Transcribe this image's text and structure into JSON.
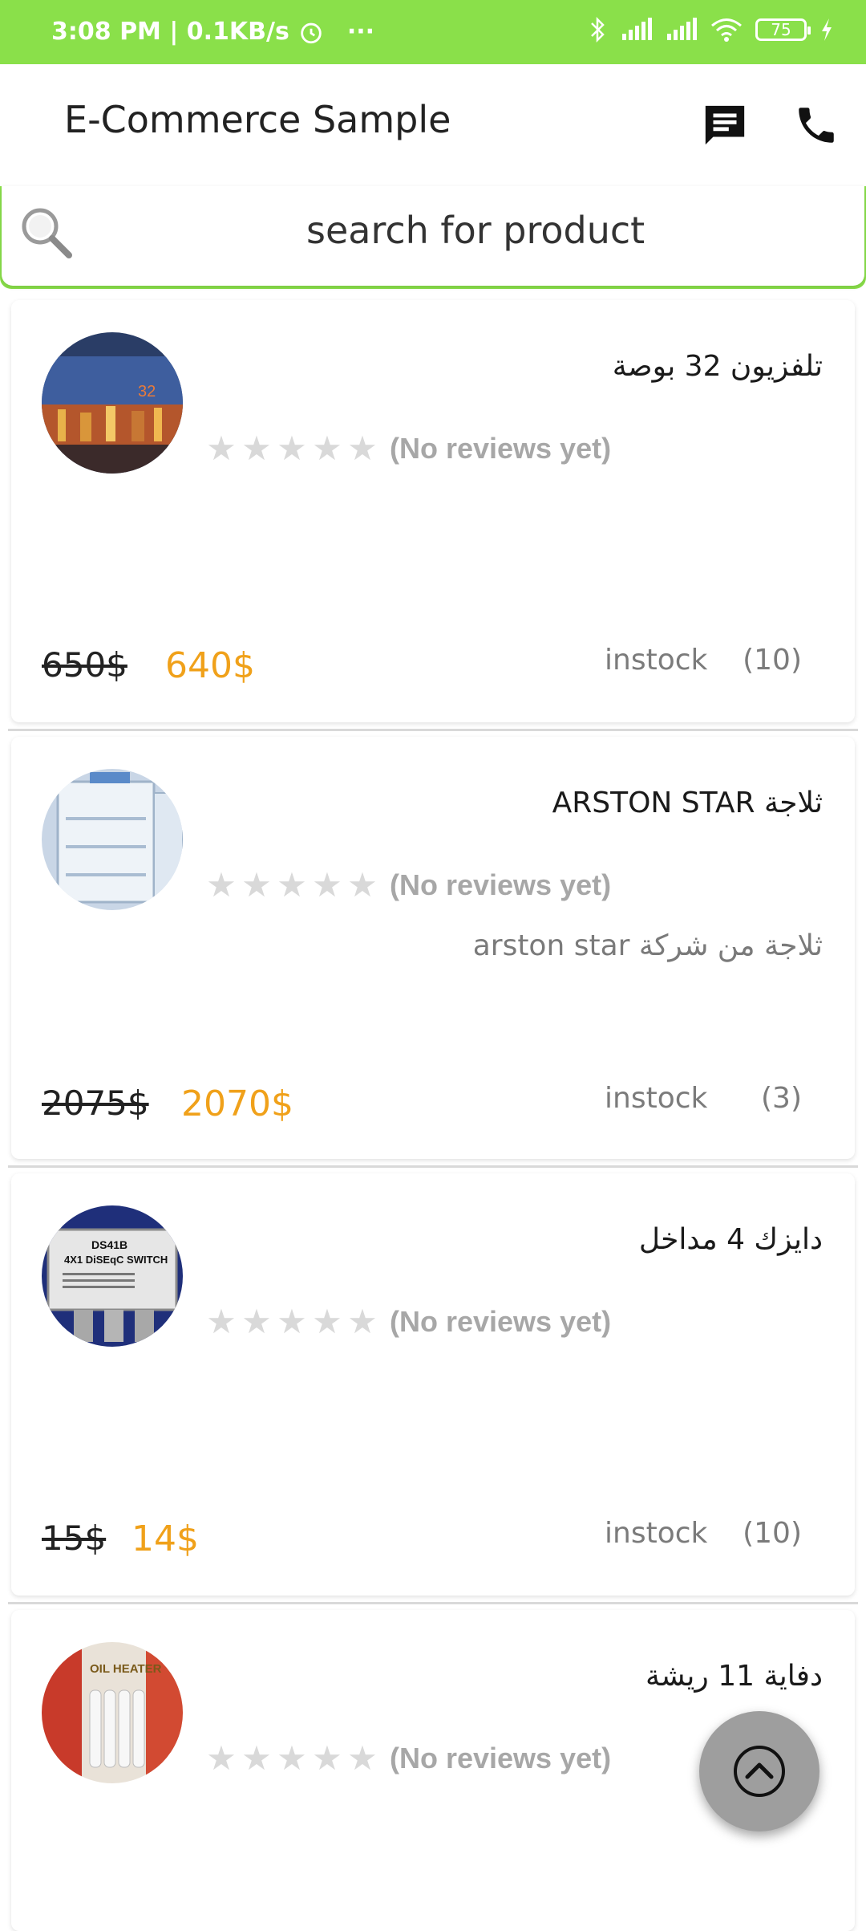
{
  "status_bar": {
    "time": "3:08 PM | 0.1KB/s",
    "more": "···",
    "battery": "75"
  },
  "app_bar": {
    "title": "E-Commerce Sample",
    "icons": [
      "chat-icon",
      "phone-icon"
    ]
  },
  "search": {
    "placeholder": "search for product"
  },
  "rating": {
    "no_reviews_label": "(No reviews yet)"
  },
  "products": [
    {
      "title": "تلفزيون 32 بوصة",
      "description": "",
      "old_price": "650$",
      "new_price": "640$",
      "stock_label": "instock",
      "quantity": "(10)",
      "stars": 0
    },
    {
      "title": "ثلاجة ARSTON STAR",
      "description": "ثلاجة من شركة arston star",
      "old_price": "2075$",
      "new_price": "2070$",
      "stock_label": "instock",
      "quantity": "(3)",
      "stars": 0
    },
    {
      "title": "دايزك 4 مداخل",
      "description": "",
      "old_price": "15$",
      "new_price": "14$",
      "stock_label": "instock",
      "quantity": "(10)",
      "stars": 0
    },
    {
      "title": "دفاية 11 ريشة",
      "description": "",
      "stars": 0
    }
  ],
  "colors": {
    "accent_green": "#8ae04a",
    "price_orange": "#f0a11a",
    "text_gray": "#7b7b7b",
    "star_gray": "#d9d9d9"
  }
}
